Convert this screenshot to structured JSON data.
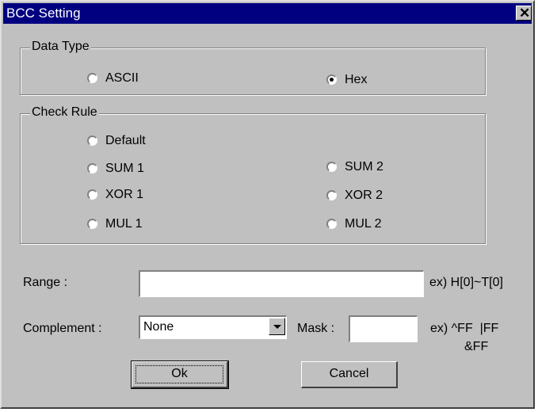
{
  "window": {
    "title": "BCC Setting"
  },
  "data_type": {
    "legend": "Data Type",
    "options": {
      "ascii": "ASCII",
      "hex": "Hex"
    },
    "selected": "Hex"
  },
  "check_rule": {
    "legend": "Check Rule",
    "options": {
      "default": "Default",
      "sum1": "SUM 1",
      "sum2": "SUM 2",
      "xor1": "XOR 1",
      "xor2": "XOR 2",
      "mul1": "MUL 1",
      "mul2": "MUL 2"
    },
    "selected": null
  },
  "range": {
    "label": "Range :",
    "value": "",
    "example": "ex) H[0]~T[0]"
  },
  "complement": {
    "label": "Complement :",
    "value": "None"
  },
  "mask": {
    "label": "Mask :",
    "value": "",
    "example_line1": "ex) ^FF  |FF",
    "example_line2": "&FF"
  },
  "buttons": {
    "ok": "Ok",
    "cancel": "Cancel"
  }
}
